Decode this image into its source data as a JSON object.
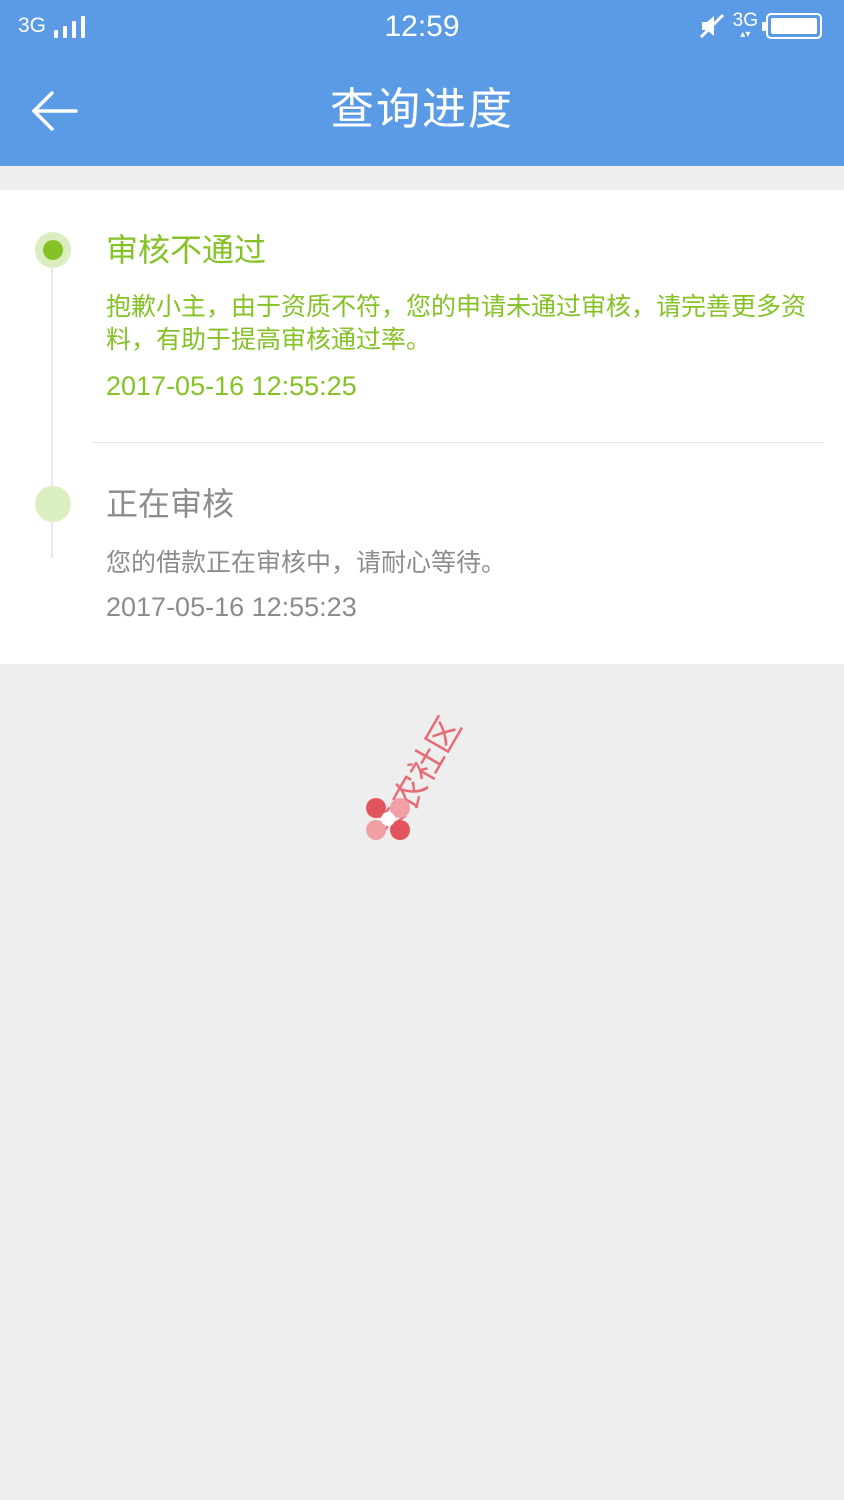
{
  "status_bar": {
    "network": "3G",
    "time": "12:59",
    "network_right": "3G",
    "icons": [
      "signal-icon",
      "mute-icon",
      "data-arrows-icon",
      "battery-icon"
    ]
  },
  "header": {
    "title": "查询进度",
    "back_icon": "arrow-left-icon"
  },
  "progress": [
    {
      "status": "审核不通过",
      "description": "抱歉小主，由于资质不符，您的申请未通过审核，请完善更多资料，有助于提高审核通过率。",
      "time": "2017-05-16 12:55:25",
      "state": "current"
    },
    {
      "status": "正在审核",
      "description": "您的借款正在审核中，请耐心等待。",
      "time": "2017-05-16 12:55:23",
      "state": "past"
    }
  ],
  "watermark": {
    "text": "卡农社区"
  },
  "colors": {
    "header_bg": "#5b9be6",
    "accent_green": "#84c225",
    "dot_light_green": "#daeebf",
    "text_grey": "#8c8c8c",
    "page_bg": "#eeeeee"
  }
}
